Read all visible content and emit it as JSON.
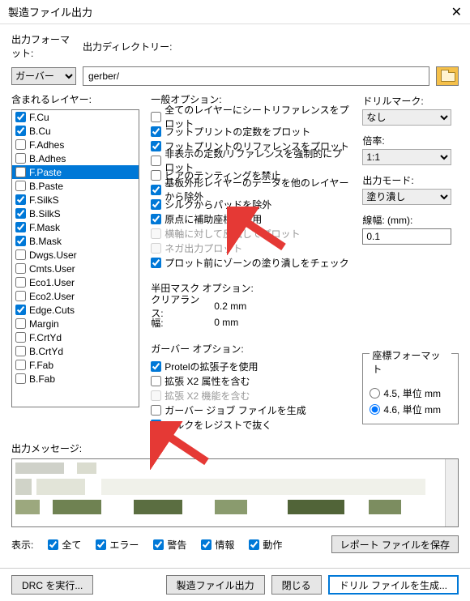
{
  "window": {
    "title": "製造ファイル出力"
  },
  "topbar": {
    "format_label": "出力フォーマット:",
    "format_value": "ガーバー",
    "dir_label": "出力ディレクトリー:",
    "dir_value": "gerber/"
  },
  "layers": {
    "label": "含まれるレイヤー:",
    "items": [
      {
        "name": "F.Cu",
        "checked": true,
        "selected": false
      },
      {
        "name": "B.Cu",
        "checked": true,
        "selected": false
      },
      {
        "name": "F.Adhes",
        "checked": false,
        "selected": false
      },
      {
        "name": "B.Adhes",
        "checked": false,
        "selected": false
      },
      {
        "name": "F.Paste",
        "checked": false,
        "selected": true
      },
      {
        "name": "B.Paste",
        "checked": false,
        "selected": false
      },
      {
        "name": "F.SilkS",
        "checked": true,
        "selected": false
      },
      {
        "name": "B.SilkS",
        "checked": true,
        "selected": false
      },
      {
        "name": "F.Mask",
        "checked": true,
        "selected": false
      },
      {
        "name": "B.Mask",
        "checked": true,
        "selected": false
      },
      {
        "name": "Dwgs.User",
        "checked": false,
        "selected": false
      },
      {
        "name": "Cmts.User",
        "checked": false,
        "selected": false
      },
      {
        "name": "Eco1.User",
        "checked": false,
        "selected": false
      },
      {
        "name": "Eco2.User",
        "checked": false,
        "selected": false
      },
      {
        "name": "Edge.Cuts",
        "checked": true,
        "selected": false
      },
      {
        "name": "Margin",
        "checked": false,
        "selected": false
      },
      {
        "name": "F.CrtYd",
        "checked": false,
        "selected": false
      },
      {
        "name": "B.CrtYd",
        "checked": false,
        "selected": false
      },
      {
        "name": "F.Fab",
        "checked": false,
        "selected": false
      },
      {
        "name": "B.Fab",
        "checked": false,
        "selected": false
      }
    ]
  },
  "general": {
    "label": "一般オプション:",
    "opts": [
      {
        "text": "全てのレイヤーにシートリファレンスをプロット",
        "checked": false,
        "disabled": false
      },
      {
        "text": "フットプリントの定数をプロット",
        "checked": true,
        "disabled": false
      },
      {
        "text": "フットプリントのリファレンスをプロット",
        "checked": true,
        "disabled": false
      },
      {
        "text": "非表示の定数/リファレンスを強制的にプロット",
        "checked": false,
        "disabled": false
      },
      {
        "text": "ビアのテンティングを禁止",
        "checked": false,
        "disabled": false
      },
      {
        "text": "基板外形レイヤーのデータを他のレイヤーから除外",
        "checked": true,
        "disabled": false
      },
      {
        "text": "シルクからパッドを除外",
        "checked": true,
        "disabled": false
      },
      {
        "text": "原点に補助座標を使用",
        "checked": true,
        "disabled": false
      },
      {
        "text": "横軸に対して反転してプロット",
        "checked": false,
        "disabled": true
      },
      {
        "text": "ネガ出力プロット",
        "checked": false,
        "disabled": true
      },
      {
        "text": "プロット前にゾーンの塗り潰しをチェック",
        "checked": true,
        "disabled": false
      }
    ]
  },
  "solder": {
    "label": "半田マスク オプション:",
    "clearance_k": "クリアランス:",
    "clearance_v": "0.2 mm",
    "width_k": "幅:",
    "width_v": "0 mm"
  },
  "gerber": {
    "label": "ガーバー オプション:",
    "opts": [
      {
        "text": "Protelの拡張子を使用",
        "checked": true,
        "disabled": false
      },
      {
        "text": "拡張 X2 属性を含む",
        "checked": false,
        "disabled": false
      },
      {
        "text": "拡張 X2 機能を含む",
        "checked": false,
        "disabled": true
      },
      {
        "text": "ガーバー ジョブ ファイルを生成",
        "checked": false,
        "disabled": false
      },
      {
        "text": "シルクをレジストで抜く",
        "checked": true,
        "disabled": false
      }
    ]
  },
  "right": {
    "drill_label": "ドリルマーク:",
    "drill_value": "なし",
    "scale_label": "倍率:",
    "scale_value": "1:1",
    "mode_label": "出力モード:",
    "mode_value": "塗り潰し",
    "lw_label": "線幅: (mm):",
    "lw_value": "0.1",
    "coord_legend": "座標フォーマット",
    "r1": "4.5, 単位 mm",
    "r2": "4.6, 単位 mm"
  },
  "messages": {
    "label": "出力メッセージ:",
    "show_label": "表示:",
    "all": "全て",
    "err": "エラー",
    "warn": "警告",
    "info": "情報",
    "act": "動作",
    "save": "レポート ファイルを保存"
  },
  "buttons": {
    "drc": "DRC を実行...",
    "plot": "製造ファイル出力",
    "close": "閉じる",
    "drill": "ドリル ファイルを生成..."
  }
}
